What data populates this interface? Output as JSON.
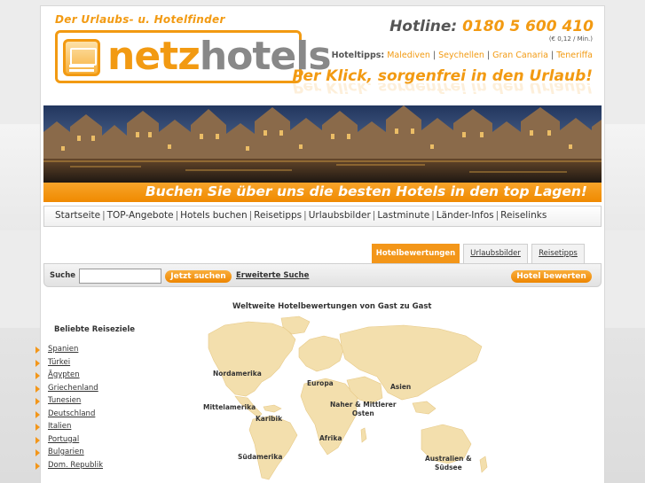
{
  "header": {
    "tagline": "Der Urlaubs- u. Hotelfinder",
    "logo_brand": "netz",
    "logo_brand_bold": "hotels",
    "hotline_label": "Hotline:",
    "hotline_number": "0180 5 600 410",
    "hotline_price": "(€ 0,12 / Min.)",
    "hoteltipps_label": "Hoteltipps:",
    "hoteltipps": [
      "Malediven",
      "Seychellen",
      "Gran Canaria",
      "Teneriffa"
    ],
    "slogan": "Per Klick, sorgenfrei in den Urlaub!"
  },
  "banner": {
    "text": "Buchen Sie über uns die besten Hotels in den top Lagen!"
  },
  "nav": {
    "items": [
      "Startseite",
      "TOP-Angebote",
      "Hotels buchen",
      "Reisetipps",
      "Urlaubsbilder",
      "Lastminute",
      "Länder-Infos",
      "Reiselinks"
    ]
  },
  "tabs": [
    "Hotelbewertungen",
    "Urlaubsbilder",
    "Reisetipps"
  ],
  "search": {
    "label": "Suche",
    "value": "",
    "button": "Jetzt suchen",
    "extended_link": "Erweiterte Suche",
    "rate_button": "Hotel bewerten"
  },
  "main": {
    "map_title": "Weltweite Hotelbewertungen von Gast zu Gast",
    "destinations_title": "Beliebte Reiseziele",
    "destinations": [
      "Spanien",
      "Türkei",
      "Ägypten",
      "Griechenland",
      "Tunesien",
      "Deutschland",
      "Italien",
      "Portugal",
      "Bulgarien",
      "Dom. Republik"
    ],
    "map_regions": {
      "nordamerika": "Nordamerika",
      "mittelamerika": "Mittelamerika",
      "karibik": "Karibik",
      "suedamerika": "Südamerika",
      "europa": "Europa",
      "afrika": "Afrika",
      "naher_osten_1": "Naher & Mittlerer",
      "naher_osten_2": "Osten",
      "asien": "Asien",
      "australien_1": "Australien &",
      "australien_2": "Südsee"
    }
  },
  "colors": {
    "accent": "#f39619",
    "text": "#333333"
  }
}
